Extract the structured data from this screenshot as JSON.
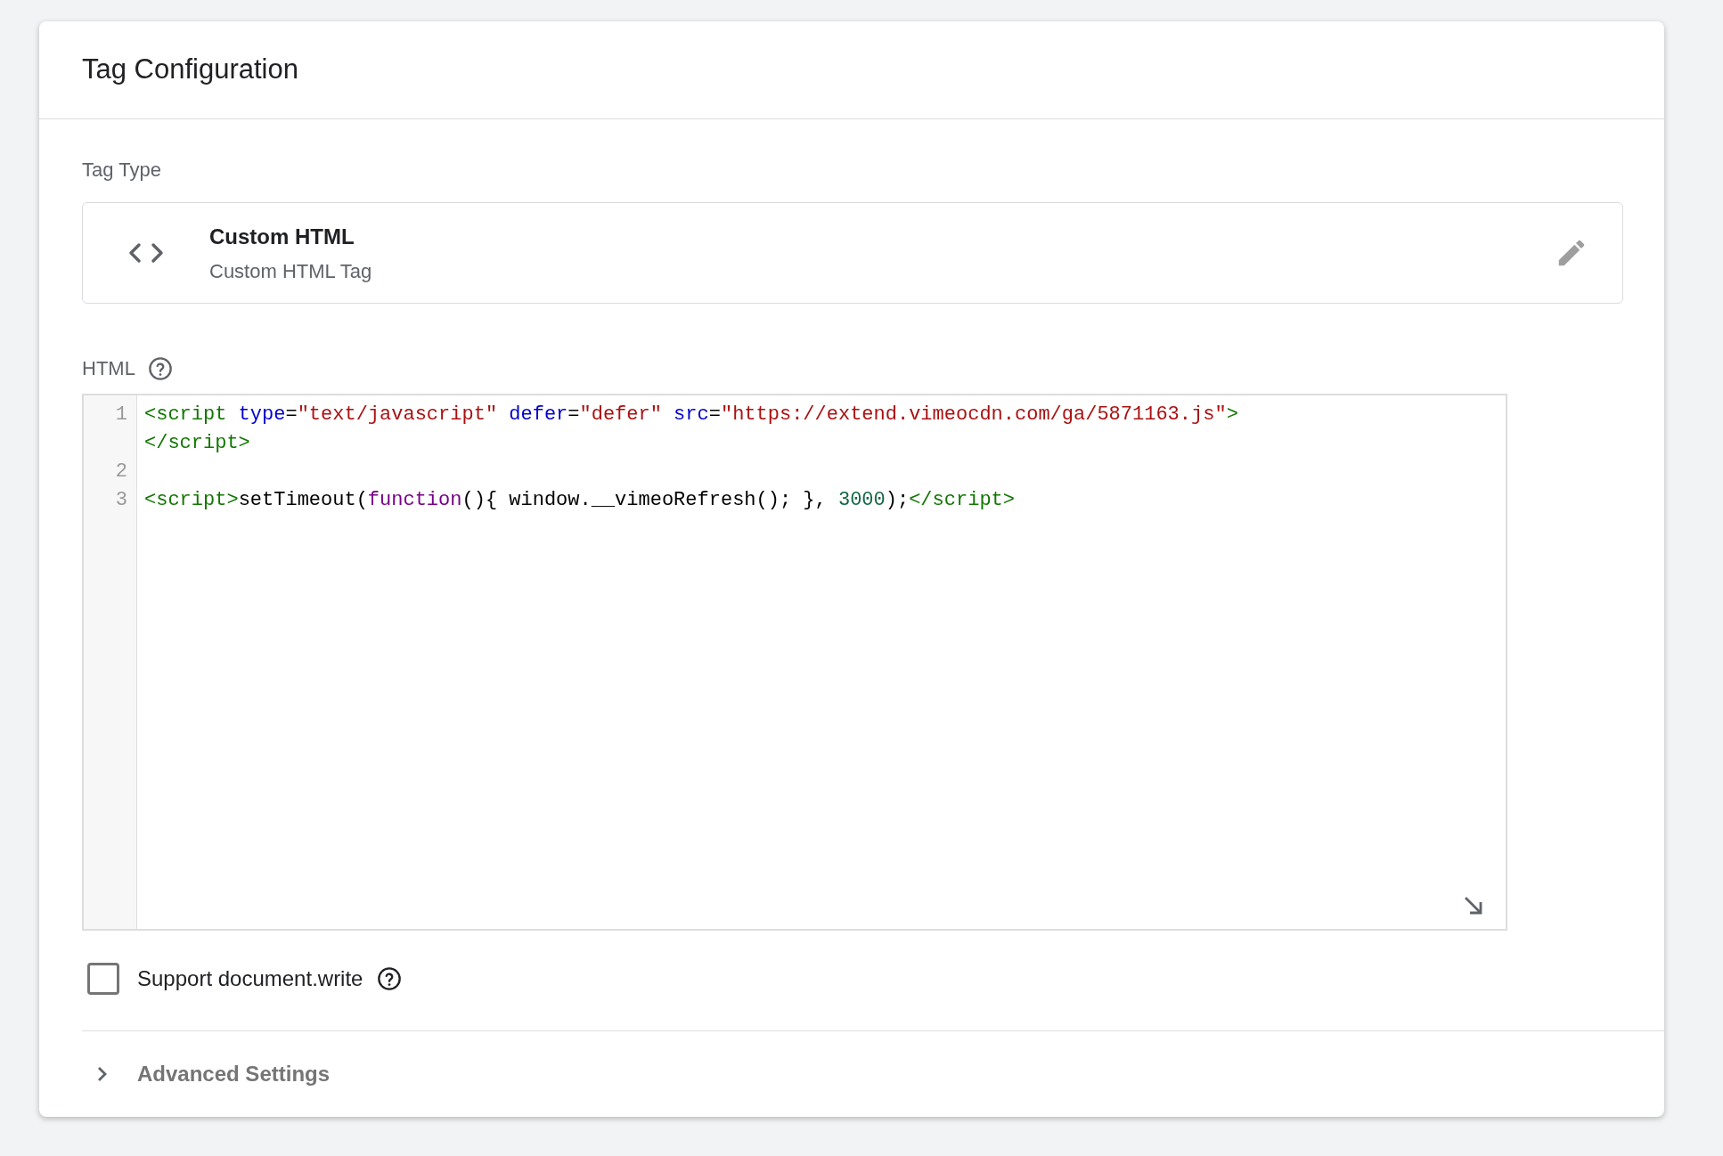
{
  "card": {
    "title": "Tag Configuration"
  },
  "tag_type": {
    "label": "Tag Type",
    "name": "Custom HTML",
    "description": "Custom HTML Tag"
  },
  "html": {
    "label": "HTML",
    "lines": [
      {
        "number": "1",
        "rows": [
          [
            {
              "kind": "tag",
              "text": "<script"
            },
            {
              "kind": "attr",
              "text": " type"
            },
            {
              "kind": "plain",
              "text": "="
            },
            {
              "kind": "string",
              "text": "\"text/javascript\""
            },
            {
              "kind": "attr",
              "text": " defer"
            },
            {
              "kind": "plain",
              "text": "="
            },
            {
              "kind": "string",
              "text": "\"defer\""
            },
            {
              "kind": "attr",
              "text": " src"
            },
            {
              "kind": "plain",
              "text": "="
            },
            {
              "kind": "string",
              "text": "\"https://extend.vimeocdn.com/ga/5871163.js\""
            },
            {
              "kind": "tag",
              "text": ">"
            }
          ],
          [
            {
              "kind": "tag",
              "text": "</script>"
            }
          ]
        ]
      },
      {
        "number": "2",
        "rows": [
          []
        ]
      },
      {
        "number": "3",
        "rows": [
          [
            {
              "kind": "tag",
              "text": "<script>"
            },
            {
              "kind": "plain",
              "text": "setTimeout("
            },
            {
              "kind": "keyword",
              "text": "function"
            },
            {
              "kind": "plain",
              "text": "(){ window.__vimeoRefresh(); }, "
            },
            {
              "kind": "number",
              "text": "3000"
            },
            {
              "kind": "plain",
              "text": ");"
            },
            {
              "kind": "tag",
              "text": "</script>"
            }
          ]
        ]
      }
    ]
  },
  "support_document_write": {
    "label": "Support document.write",
    "checked": false
  },
  "advanced_settings": {
    "label": "Advanced Settings",
    "expanded": false
  }
}
